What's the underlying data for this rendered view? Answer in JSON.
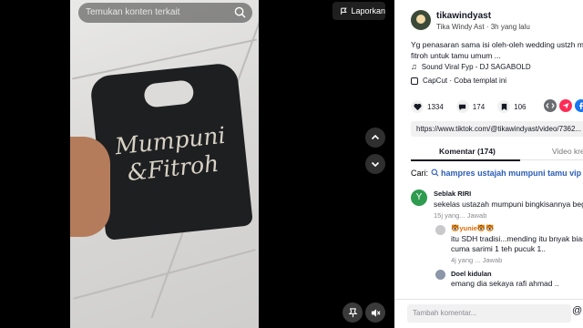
{
  "search": {
    "placeholder": "Temukan konten terkait"
  },
  "report_label": "Laporkan",
  "video": {
    "bag_line1": "Mumpuni",
    "bag_line2": "&Fitroh"
  },
  "author": {
    "username": "tikawindyast",
    "display_and_time": "Tika Windy Ast · 3h yang lalu"
  },
  "description": "Yg penasaran sama isi oleh-oleh wedding ustzh m gus fitroh untuk tamu umum ...",
  "music": "Sound Viral Fyp - DJ SAGABOLD",
  "capcut": "CapCut · Coba templat ini",
  "stats": {
    "likes": "1334",
    "comments": "174",
    "saves": "106"
  },
  "url": "https://www.tiktok.com/@tikawindyast/video/7362...",
  "tabs": {
    "comments": "Komentar (174)",
    "other": "Video kre"
  },
  "search_suggestion": {
    "prefix": "Cari:",
    "query": "hampres ustajah mumpuni tamu vip"
  },
  "comments": [
    {
      "avatar_letter": "Y",
      "avatar_color": "#2e9b4e",
      "name": "Seblak RIRI",
      "text": "sekelas ustazah mumpuni bingkisannya beg",
      "meta": "15j yang... Jawab"
    },
    {
      "name": "🐯yunie🐯🐯",
      "text_line1": "itu SDH tradisi...mending itu bnyak bias",
      "text_line2": "cuma sarimi 1 teh pucuk 1..",
      "meta": "4j yang ... Jawab"
    },
    {
      "name": "Doel kidulan",
      "text": "emang dia sekaya rafi ahmad ..",
      "meta": ""
    }
  ],
  "footer": {
    "placeholder": "Tambah komentar..."
  },
  "colors": {
    "tiktok_red": "#fe2c55",
    "link_blue": "#2b5db9",
    "facebook_blue": "#1877f2"
  }
}
